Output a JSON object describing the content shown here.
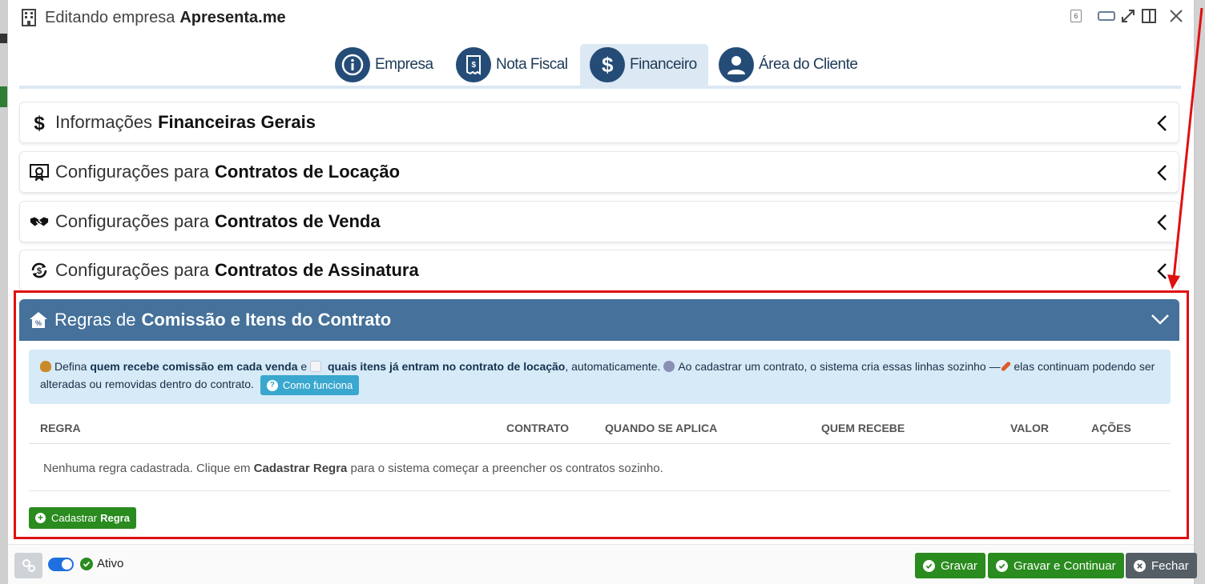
{
  "window": {
    "title_prefix": "Editando empresa",
    "title_name": "Apresenta.me",
    "badge": "6"
  },
  "tabs": [
    {
      "label": "Empresa",
      "icon": "info-icon",
      "active": false
    },
    {
      "label": "Nota Fiscal",
      "icon": "invoice-icon",
      "active": false
    },
    {
      "label": "Financeiro",
      "icon": "dollar-icon",
      "active": true
    },
    {
      "label": "Área do Cliente",
      "icon": "user-icon",
      "active": false
    }
  ],
  "panels": [
    {
      "light": "Informações",
      "bold": "Financeiras Gerais",
      "icon": "dollar-icon"
    },
    {
      "light": "Configurações para",
      "bold": "Contratos de Locação",
      "icon": "certificate-icon"
    },
    {
      "light": "Configurações para",
      "bold": "Contratos de Venda",
      "icon": "handshake-icon"
    },
    {
      "light": "Configurações para",
      "bold": "Contratos de Assinatura",
      "icon": "recurring-dollar-icon"
    }
  ],
  "open_panel": {
    "light": "Regras de",
    "bold": "Comissão e Itens do Contrato",
    "icon": "house-percent-icon"
  },
  "info": {
    "t1": "Defina",
    "b1": "quem recebe comissão em cada venda",
    "t2": "e",
    "b2": "quais itens já entram no contrato de locação",
    "t3": ", automaticamente.",
    "t4": "Ao cadastrar um contrato, o sistema cria essas linhas sozinho —",
    "t5": "elas continuam podendo ser alteradas ou removidas dentro do contrato.",
    "button": "Como funciona"
  },
  "table": {
    "headers": [
      "REGRA",
      "CONTRATO",
      "QUANDO SE APLICA",
      "QUEM RECEBE",
      "VALOR",
      "AÇÕES"
    ],
    "empty_t1": "Nenhuma regra cadastrada. Clique em",
    "empty_b": "Cadastrar Regra",
    "empty_t2": "para o sistema começar a preencher os contratos sozinho."
  },
  "add_button": {
    "light": "Cadastrar",
    "bold": "Regra"
  },
  "footer": {
    "status": "Ativo",
    "save": "Gravar",
    "save_continue": "Gravar e Continuar",
    "close": "Fechar"
  },
  "colors": {
    "accent_dark": "#244c77",
    "panel_open": "#45719a",
    "success": "#2a8b1e",
    "info_bg": "#d6eaf7",
    "highlight": "#e01010"
  }
}
